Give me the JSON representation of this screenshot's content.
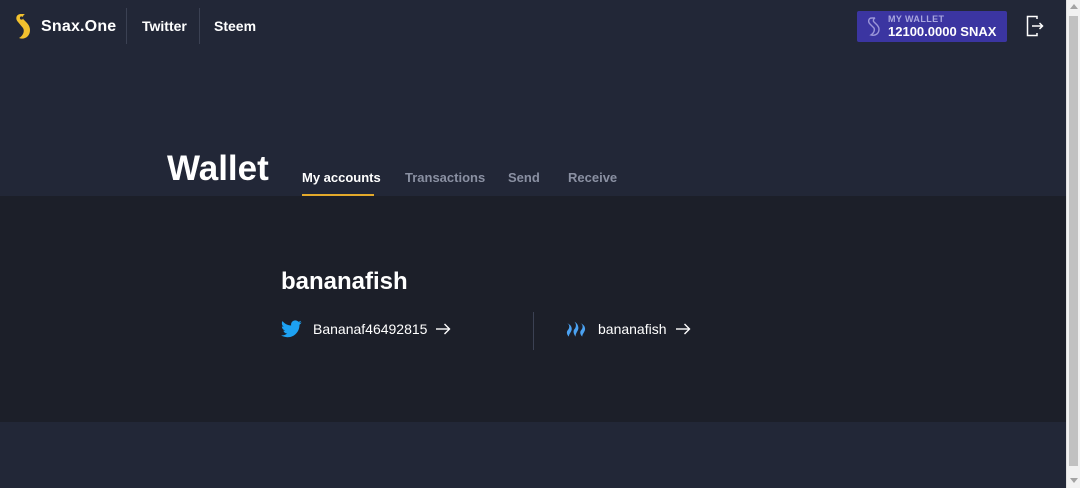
{
  "app": {
    "brand": "Snax.One",
    "nav": [
      "Twitter",
      "Steem"
    ]
  },
  "wallet_badge": {
    "caption": "MY WALLET",
    "amount": "12100.0000 SNAX"
  },
  "page": {
    "title": "Wallet",
    "tabs": [
      {
        "label": "My accounts",
        "active": true
      },
      {
        "label": "Transactions",
        "active": false
      },
      {
        "label": "Send",
        "active": false
      },
      {
        "label": "Receive",
        "active": false
      }
    ]
  },
  "account": {
    "name": "bananafish",
    "links": [
      {
        "network": "twitter",
        "handle": "Bananaf46492815",
        "icon": "twitter-bird-icon"
      },
      {
        "network": "steem",
        "handle": "bananafish",
        "icon": "steem-icon"
      }
    ]
  },
  "colors": {
    "background": "#222737",
    "panel": "#1c1f29",
    "accent": "#e3a92b",
    "wallet_badge": "#3b35a1",
    "twitter": "#1da1f2",
    "steem": "#4ba2f2"
  }
}
